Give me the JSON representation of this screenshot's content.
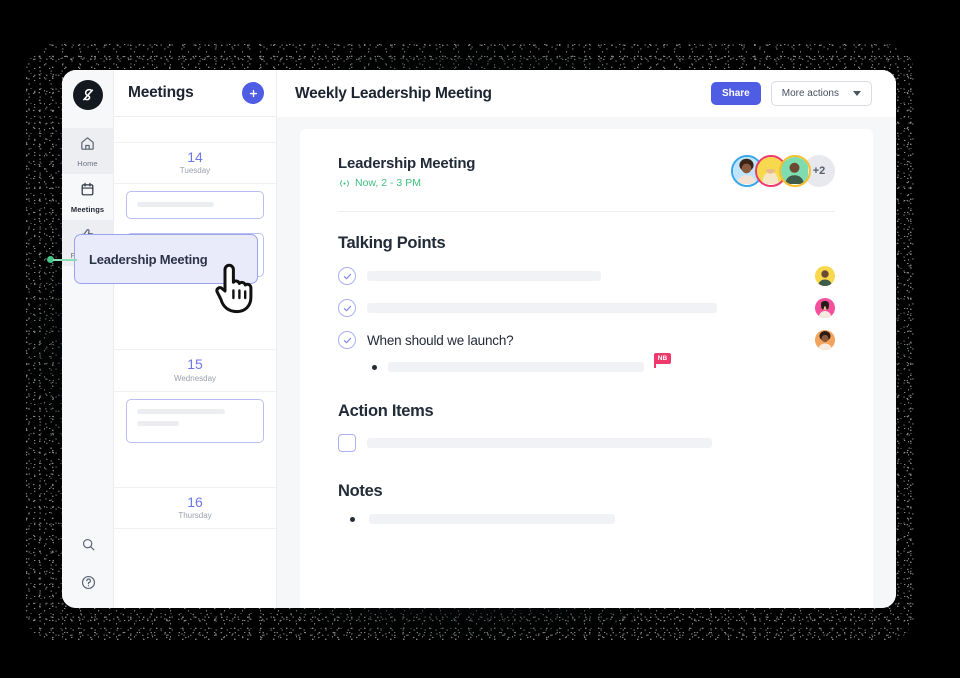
{
  "app": {
    "logo_name": "app-logo"
  },
  "rail": {
    "items": [
      {
        "label": "Home",
        "icon": "home-icon"
      },
      {
        "label": "Meetings",
        "icon": "calendar-icon"
      },
      {
        "label": "Feedback",
        "icon": "thumbs-up-icon"
      }
    ],
    "bottom": [
      {
        "icon": "search-icon"
      },
      {
        "icon": "help-circle-icon"
      }
    ]
  },
  "meetings_panel": {
    "title": "Meetings",
    "add_label": "+",
    "days": [
      {
        "num": "14",
        "name": "Tuesday"
      },
      {
        "num": "15",
        "name": "Wednesday"
      },
      {
        "num": "16",
        "name": "Thursday"
      }
    ],
    "tooltip": "Leadership Meeting"
  },
  "main": {
    "title": "Weekly Leadership Meeting",
    "share_label": "Share",
    "more_actions_label": "More actions",
    "meeting": {
      "name": "Leadership Meeting",
      "time": "Now, 2 - 3 PM",
      "live_icon": "live-broadcast-icon",
      "overflow_count": "+2"
    },
    "sections": {
      "talking_points": {
        "title": "Talking Points",
        "items": [
          {
            "text": "",
            "done": true
          },
          {
            "text": "",
            "done": true
          },
          {
            "text": "When should we launch?",
            "done": true
          }
        ],
        "sub_item_flag": "NB"
      },
      "action_items": {
        "title": "Action Items"
      },
      "notes": {
        "title": "Notes"
      }
    }
  },
  "colors": {
    "accent": "#4f5de4",
    "accent_soft": "#6d78e8",
    "live_green": "#3fbf7f",
    "flag_pink": "#f0396b",
    "placeholder": "#f1f2f5",
    "ring_blue": "#35a7e8",
    "ring_pink": "#f0396b",
    "ring_yellow": "#f5c02c"
  }
}
